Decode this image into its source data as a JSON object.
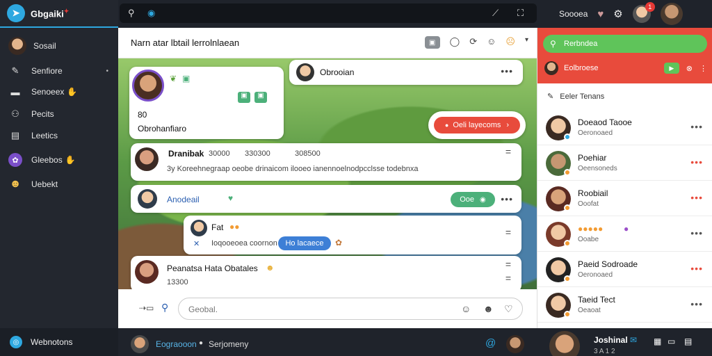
{
  "colors": {
    "accent": "#2ea8e0",
    "danger": "#e84b3c",
    "success": "#5fc45a",
    "notification": "#e53935",
    "pill_red": "#e84b3c",
    "pill_blue": "#3d7fd6",
    "pill_green": "#4cb07a"
  },
  "app": {
    "name": "Gbgaiki"
  },
  "sidebar": {
    "profile_label": "Sosail",
    "items": [
      {
        "label": "Senfiore",
        "icon": "pen-icon"
      },
      {
        "label": "Senoeex",
        "icon": "square-icon"
      },
      {
        "label": "Pecits",
        "icon": "group-icon"
      },
      {
        "label": "Leetics",
        "icon": "folder-icon"
      },
      {
        "label": "Gleebos",
        "icon": "globe-icon"
      },
      {
        "label": "Uebekt",
        "icon": "smile-icon"
      }
    ],
    "bottom_label": "Webnotons"
  },
  "topbar": {
    "user_label": "Soooea",
    "notification_count": "1"
  },
  "main": {
    "title": "Narn atar lbtail lerrolnlaean",
    "card1": {
      "number": "80",
      "text": "Obrohanfiaro"
    },
    "card2": {
      "name": "Obrooian"
    },
    "cta": {
      "label": "Oeli layecoms"
    },
    "post1": {
      "name": "Dranibak",
      "meta1": "30000",
      "meta2": "330300",
      "meta3": "308500",
      "body": "3y Koreehnegraap oeobe drinaicom ilooeo ianennoelnodpcclsse todebnxa"
    },
    "post2": {
      "name": "Anodeail",
      "pill": "Ooe"
    },
    "post3": {
      "name": "Fat",
      "body": "Ioqooeoea coornon",
      "pill": "Ho lacaece"
    },
    "post4": {
      "name": "Peanatsa Hata Obatales",
      "sub": "13300"
    },
    "composer": {
      "placeholder": "Geobal."
    }
  },
  "main_bottom": {
    "name": "Eograooon",
    "label": "Serjomeny"
  },
  "right": {
    "search_label": "Rerbndea",
    "sub_label": "Eolbroese",
    "section_title": "Eeler Tenans",
    "contacts": [
      {
        "name": "Doeaod Taooe",
        "status": "Oeronoaed"
      },
      {
        "name": "Poehiar",
        "status": "Oeensoneds"
      },
      {
        "name": "Roobiail",
        "status": "Ooofat"
      },
      {
        "name": "",
        "status": "Ooabe"
      },
      {
        "name": "Paeid Sodroade",
        "status": "Oeronoaed"
      },
      {
        "name": "Taeid Tect",
        "status": "Oeaoat"
      }
    ]
  },
  "right_bottom": {
    "name": "Joshinal",
    "sub": "3 A 1 2"
  }
}
